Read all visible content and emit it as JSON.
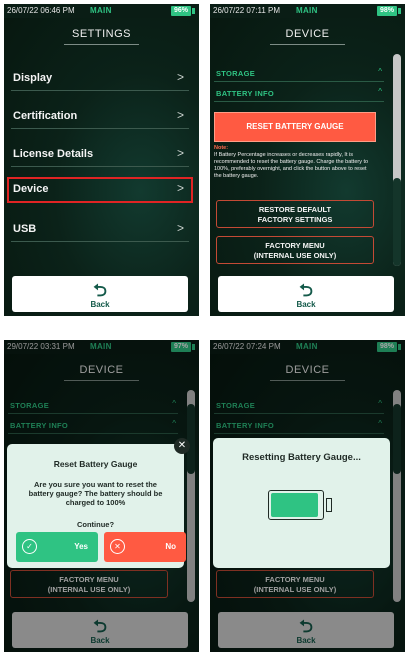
{
  "colors": {
    "accent_green": "#2fc383",
    "reset_red": "#ff5a42",
    "selection_red": "#e02424",
    "dialog_bg": "#e1f2ea"
  },
  "screens": {
    "settings": {
      "status": {
        "time": "26/07/22 06:46 PM",
        "mode": "MAIN",
        "battery": "96%"
      },
      "title": "SETTINGS",
      "menu": [
        {
          "label": "Display",
          "icon": "chevron-right-icon"
        },
        {
          "label": "Certification",
          "icon": "chevron-right-icon"
        },
        {
          "label": "License Details",
          "icon": "chevron-right-icon"
        },
        {
          "label": "Device",
          "icon": "chevron-right-icon",
          "selected": true
        },
        {
          "label": "USB",
          "icon": "chevron-right-icon"
        }
      ],
      "chevron": ">",
      "back": {
        "arrow": "⮌",
        "label": "Back"
      }
    },
    "device": {
      "status": {
        "time": "26/07/22 07:11 PM",
        "mode": "MAIN",
        "battery": "98%"
      },
      "title": "DEVICE",
      "caret": "^",
      "sections": {
        "storage": "STORAGE",
        "battery_info": "BATTERY INFO"
      },
      "reset_button": "RESET BATTERY GAUGE",
      "note_label": "Note:",
      "note_text": "If Battery Percentage increases or decreases rapidly, It is recommended to reset the battery gauge. Charge the battery to 100%, preferably overnight, and click the button above to reset the battery gauge.",
      "restore_button": {
        "line1": "RESTORE DEFAULT",
        "line2": "FACTORY SETTINGS"
      },
      "factory_menu_button": {
        "line1": "FACTORY MENU",
        "line2": "(INTERNAL USE ONLY)"
      },
      "back": {
        "arrow": "⮌",
        "label": "Back"
      }
    },
    "confirm": {
      "status": {
        "time": "29/07/22 03:31 PM",
        "mode": "MAIN",
        "battery": "97%"
      },
      "title": "DEVICE",
      "caret": "^",
      "sections": {
        "storage": "STORAGE",
        "battery_info": "BATTERY INFO"
      },
      "factory_menu_button": {
        "line1": "FACTORY MENU",
        "line2": "(INTERNAL USE ONLY)"
      },
      "dialog": {
        "title": "Reset Battery Gauge",
        "message": "Are you sure you  want to reset the battery gauge? The battery should be charged to 100%",
        "continue": "Continue?",
        "close": "✕",
        "yes": "Yes",
        "yes_icon": "✓",
        "no": "No",
        "no_icon": "✕"
      },
      "back": {
        "arrow": "⮌",
        "label": "Back"
      }
    },
    "resetting": {
      "status": {
        "time": "26/07/22 07:24 PM",
        "mode": "MAIN",
        "battery": "98%"
      },
      "title": "DEVICE",
      "caret": "^",
      "sections": {
        "storage": "STORAGE",
        "battery_info": "BATTERY INFO"
      },
      "factory_menu_button": {
        "line1": "FACTORY MENU",
        "line2": "(INTERNAL USE ONLY)"
      },
      "dialog": {
        "title": "Resetting Battery Gauge...",
        "battery_fill": 0.95
      },
      "back": {
        "arrow": "⮌",
        "label": "Back"
      }
    }
  }
}
